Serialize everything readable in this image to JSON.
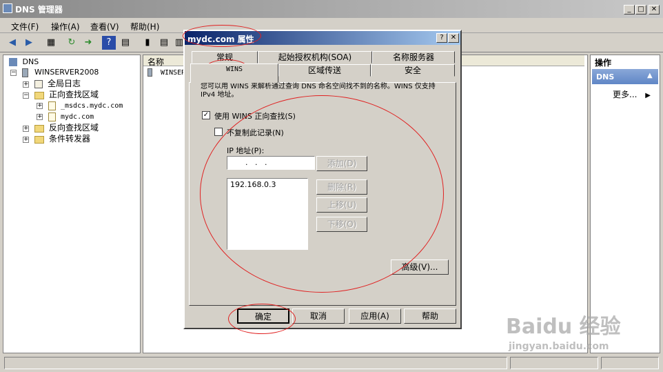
{
  "window": {
    "title": "DNS 管理器",
    "menu": [
      "文件(F)",
      "操作(A)",
      "查看(V)",
      "帮助(H)"
    ]
  },
  "tree": {
    "root": "DNS",
    "server": "WINSERVER2008",
    "items": [
      "全局日志",
      "正向查找区域",
      "_msdcs.mydc.com",
      "mydc.com",
      "反向查找区域",
      "条件转发器"
    ]
  },
  "list": {
    "column_name": "名称",
    "row1": "WINSERVER"
  },
  "actions": {
    "header": "操作",
    "dns": "DNS",
    "more": "更多..."
  },
  "dialog": {
    "title": "mydc.com 属性",
    "help_btn": "?",
    "close_btn": "✕",
    "tabs_row1": [
      "常规",
      "起始授权机构(SOA)",
      "名称服务器"
    ],
    "tabs_row2": [
      "WINS",
      "区域传送",
      "安全"
    ],
    "description": "您可以用 WINS 来解析通过查询 DNS 命名空间找不到的名称。WINS 仅支持 IPv4 地址。",
    "use_wins_label": "使用 WINS 正向查找(S)",
    "use_wins_checked": true,
    "no_replicate_label": "不复制此记录(N)",
    "no_replicate_checked": false,
    "ip_label": "IP 地址(P):",
    "ip_placeholder": ".   .   .",
    "add_btn": "添加(D)",
    "ip_list": [
      "192.168.0.3"
    ],
    "remove_btn": "删除(R)",
    "up_btn": "上移(U)",
    "down_btn": "下移(O)",
    "advanced_btn": "高级(V)...",
    "ok_btn": "确定",
    "cancel_btn": "取消",
    "apply_btn": "应用(A)",
    "help_bottom_btn": "帮助"
  },
  "watermark": {
    "brand": "Baidu 经验",
    "url": "jingyan.baidu.com"
  },
  "colors": {
    "annotation": "#e02020",
    "dialog_title": "#0a246a",
    "actions_header": "#5f86c6"
  }
}
